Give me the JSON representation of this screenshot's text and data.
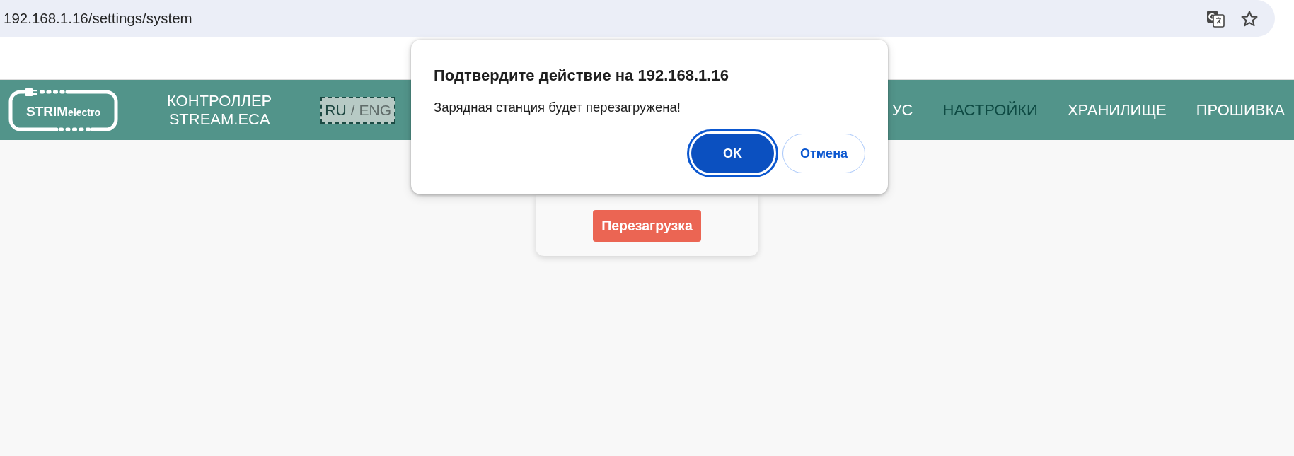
{
  "browser": {
    "url": "192.168.1.16/settings/system"
  },
  "header": {
    "logo": {
      "brand": "STRIM",
      "suffix": "electro"
    },
    "title": [
      "КОНТРОЛЛЕР",
      "STREAM.ECA"
    ],
    "languages": [
      {
        "label": "RU",
        "selected": true
      },
      {
        "label": "ENG",
        "selected": false
      }
    ],
    "language_separator": "/",
    "nav": [
      {
        "label": "УС",
        "selected": false
      },
      {
        "label": "НАСТРОЙКИ",
        "selected": true
      },
      {
        "label": "ХРАНИЛИЩЕ",
        "selected": false
      },
      {
        "label": "ПРОШИВКА",
        "selected": false
      }
    ]
  },
  "main": {
    "reboot_button": {
      "label": "Перезагрузка"
    }
  },
  "dialog": {
    "title": "Подтвердите действие на 192.168.1.16",
    "message": "Зарядная станция будет перезагружена!",
    "buttons": [
      {
        "label": "OK",
        "kind": "primary",
        "focused": true
      },
      {
        "label": "Отмена",
        "kind": "secondary",
        "focused": false
      }
    ]
  }
}
